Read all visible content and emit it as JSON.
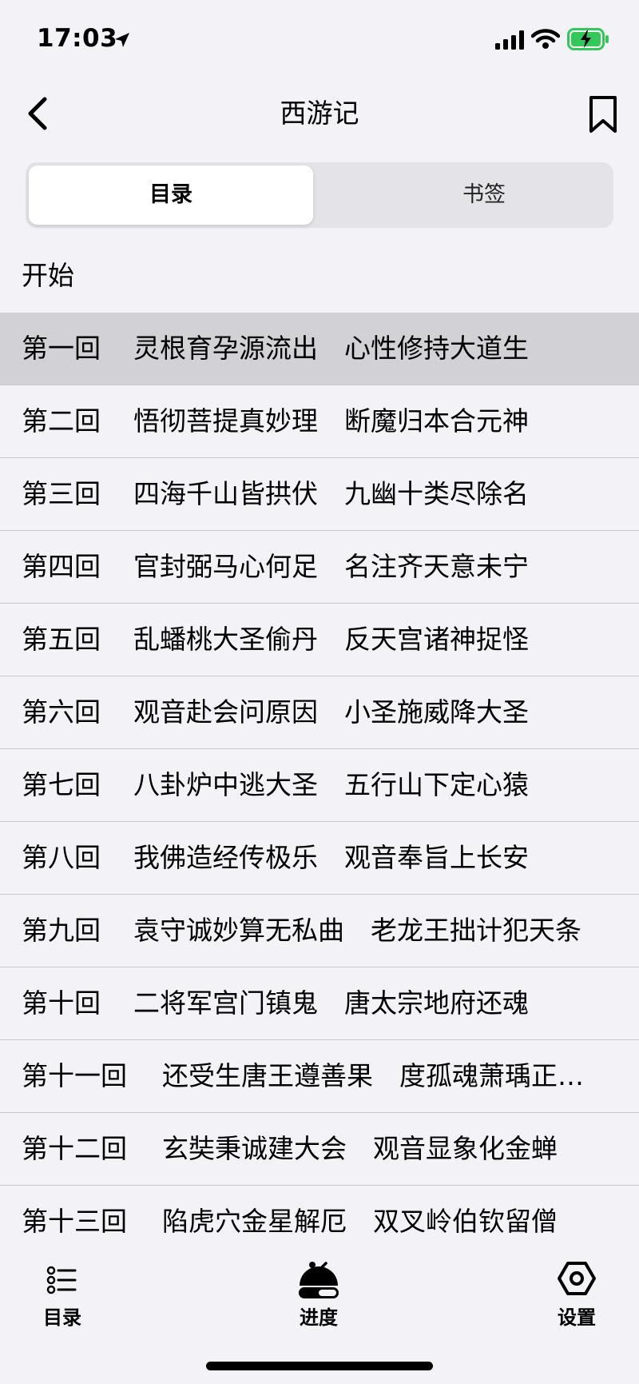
{
  "status_bar": {
    "time": "17:03"
  },
  "nav": {
    "title": "西游记"
  },
  "segmented": {
    "tabs": [
      {
        "label": "目录",
        "active": true
      },
      {
        "label": "书签",
        "active": false
      }
    ]
  },
  "section": {
    "title": "开始"
  },
  "chapters": [
    {
      "num": "第一回",
      "title": "灵根育孕源流出　心性修持大道生",
      "highlighted": true
    },
    {
      "num": "第二回",
      "title": "悟彻菩提真妙理　断魔归本合元神"
    },
    {
      "num": "第三回",
      "title": "四海千山皆拱伏　九幽十类尽除名"
    },
    {
      "num": "第四回",
      "title": "官封弼马心何足　名注齐天意未宁"
    },
    {
      "num": "第五回",
      "title": "乱蟠桃大圣偷丹　反天宫诸神捉怪"
    },
    {
      "num": "第六回",
      "title": "观音赴会问原因　小圣施威降大圣"
    },
    {
      "num": "第七回",
      "title": "八卦炉中逃大圣　五行山下定心猿"
    },
    {
      "num": "第八回",
      "title": "我佛造经传极乐　观音奉旨上长安"
    },
    {
      "num": "第九回",
      "title": "袁守诚妙算无私曲　老龙王拙计犯天条"
    },
    {
      "num": "第十回",
      "title": "二将军宫门镇鬼　唐太宗地府还魂"
    },
    {
      "num": "第十一回",
      "title": "还受生唐王遵善果　度孤魂萧瑀正…"
    },
    {
      "num": "第十二回",
      "title": "玄奘秉诚建大会　观音显象化金蝉"
    },
    {
      "num": "第十三回",
      "title": "陷虎穴金星解厄　双叉岭伯钦留僧"
    }
  ],
  "tab_bar": {
    "tabs": [
      {
        "label": "目录",
        "icon": "list-icon"
      },
      {
        "label": "进度",
        "icon": "progress-icon"
      },
      {
        "label": "设置",
        "icon": "settings-icon"
      }
    ]
  }
}
